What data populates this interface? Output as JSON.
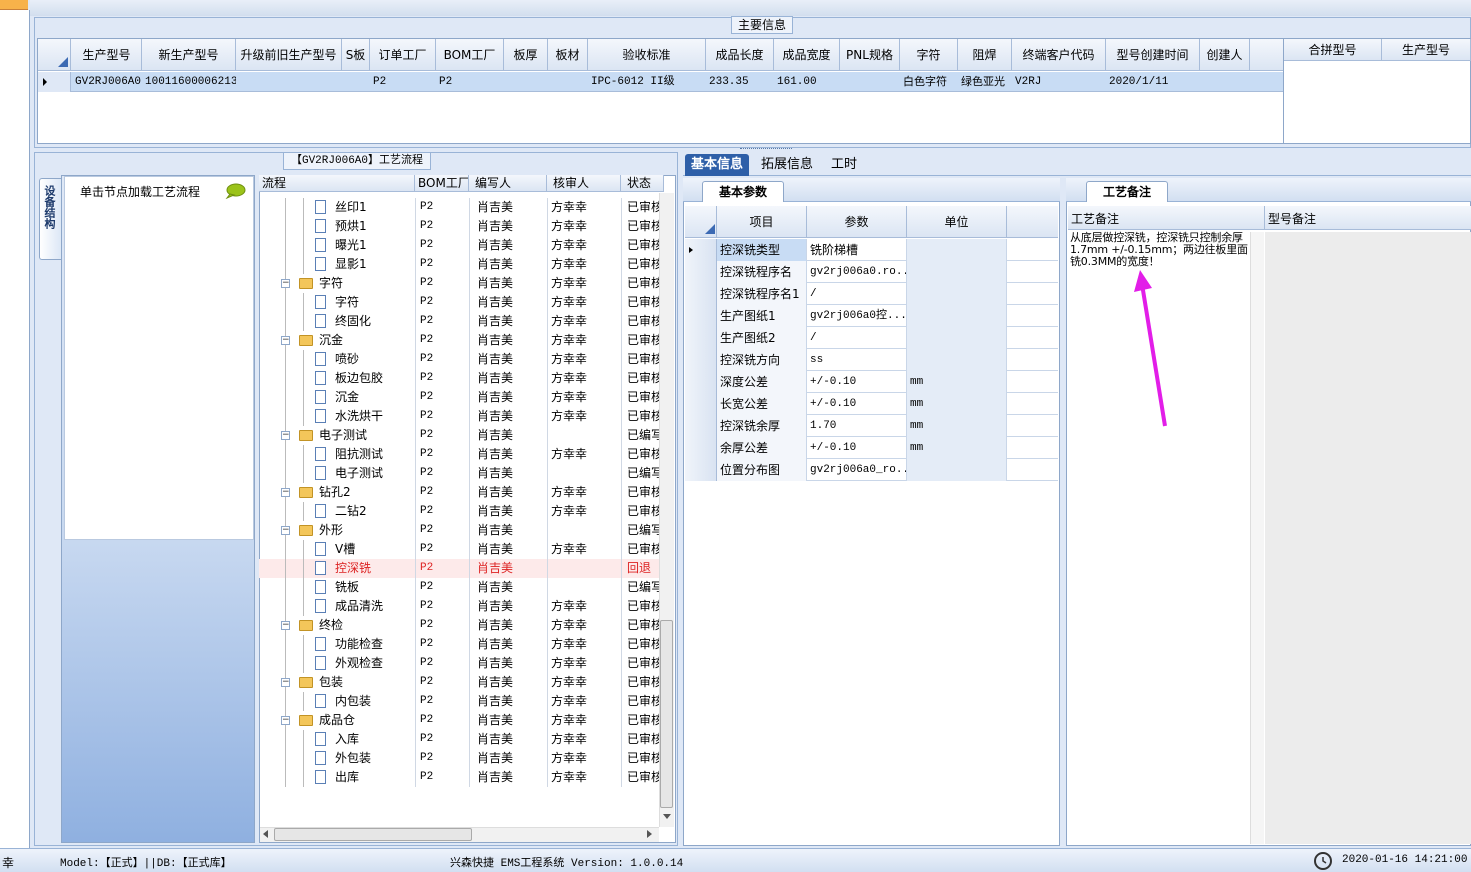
{
  "main": {
    "group_title": "主要信息",
    "columns": [
      "生产型号",
      "新生产型号",
      "升级前旧生产型号",
      "S板",
      "订单工厂",
      "BOM工厂",
      "板厚",
      "板材",
      "验收标准",
      "成品长度",
      "成品宽度",
      "PNL规格",
      "字符",
      "阻焊",
      "终端客户代码",
      "型号创建时间",
      "创建人"
    ],
    "row": [
      "GV2RJ006A0",
      "10011600006213",
      "",
      "",
      "P2",
      "P2",
      "",
      "",
      "IPC-6012 II级",
      "233.35",
      "161.00",
      "",
      "白色字符",
      "绿色亚光",
      "V2RJ",
      "2020/1/11",
      ""
    ],
    "side_columns": [
      "合拼型号",
      "生产型号"
    ]
  },
  "process": {
    "group_title": "【GV2RJ006A0】工艺流程",
    "vertical_tab": "设备结构",
    "nav_label": "单击节点加载工艺流程",
    "columns": [
      "流程",
      "BOM工厂",
      "编写人",
      "核审人",
      "状态"
    ],
    "rows": [
      {
        "name": "丝印1",
        "type": "doc",
        "level": 2,
        "bom": "P2",
        "writer": "肖吉美",
        "reviewer": "方幸幸",
        "status": "已审核"
      },
      {
        "name": "预烘1",
        "type": "doc",
        "level": 2,
        "bom": "P2",
        "writer": "肖吉美",
        "reviewer": "方幸幸",
        "status": "已审核"
      },
      {
        "name": "曝光1",
        "type": "doc",
        "level": 2,
        "bom": "P2",
        "writer": "肖吉美",
        "reviewer": "方幸幸",
        "status": "已审核"
      },
      {
        "name": "显影1",
        "type": "doc",
        "level": 2,
        "bom": "P2",
        "writer": "肖吉美",
        "reviewer": "方幸幸",
        "status": "已审核"
      },
      {
        "name": "字符",
        "type": "folder",
        "level": 1,
        "bom": "P2",
        "writer": "肖吉美",
        "reviewer": "方幸幸",
        "status": "已审核"
      },
      {
        "name": "字符",
        "type": "doc",
        "level": 2,
        "bom": "P2",
        "writer": "肖吉美",
        "reviewer": "方幸幸",
        "status": "已审核"
      },
      {
        "name": "终固化",
        "type": "doc",
        "level": 2,
        "bom": "P2",
        "writer": "肖吉美",
        "reviewer": "方幸幸",
        "status": "已审核"
      },
      {
        "name": "沉金",
        "type": "folder",
        "level": 1,
        "bom": "P2",
        "writer": "肖吉美",
        "reviewer": "方幸幸",
        "status": "已审核"
      },
      {
        "name": "喷砂",
        "type": "doc",
        "level": 2,
        "bom": "P2",
        "writer": "肖吉美",
        "reviewer": "方幸幸",
        "status": "已审核"
      },
      {
        "name": "板边包胶",
        "type": "doc",
        "level": 2,
        "bom": "P2",
        "writer": "肖吉美",
        "reviewer": "方幸幸",
        "status": "已审核"
      },
      {
        "name": "沉金",
        "type": "doc",
        "level": 2,
        "bom": "P2",
        "writer": "肖吉美",
        "reviewer": "方幸幸",
        "status": "已审核"
      },
      {
        "name": "水洗烘干",
        "type": "doc",
        "level": 2,
        "bom": "P2",
        "writer": "肖吉美",
        "reviewer": "方幸幸",
        "status": "已审核"
      },
      {
        "name": "电子测试",
        "type": "folder",
        "level": 1,
        "bom": "P2",
        "writer": "肖吉美",
        "reviewer": "",
        "status": "已编写"
      },
      {
        "name": "阻抗测试",
        "type": "doc",
        "level": 2,
        "bom": "P2",
        "writer": "肖吉美",
        "reviewer": "方幸幸",
        "status": "已审核"
      },
      {
        "name": "电子测试",
        "type": "doc",
        "level": 2,
        "bom": "P2",
        "writer": "肖吉美",
        "reviewer": "",
        "status": "已编写"
      },
      {
        "name": "钻孔2",
        "type": "folder",
        "level": 1,
        "bom": "P2",
        "writer": "肖吉美",
        "reviewer": "方幸幸",
        "status": "已审核"
      },
      {
        "name": "二钻2",
        "type": "doc",
        "level": 2,
        "bom": "P2",
        "writer": "肖吉美",
        "reviewer": "方幸幸",
        "status": "已审核"
      },
      {
        "name": "外形",
        "type": "folder",
        "level": 1,
        "bom": "P2",
        "writer": "肖吉美",
        "reviewer": "",
        "status": "已编写"
      },
      {
        "name": "V槽",
        "type": "doc",
        "level": 2,
        "bom": "P2",
        "writer": "肖吉美",
        "reviewer": "方幸幸",
        "status": "已审核"
      },
      {
        "name": "控深铣",
        "type": "doc",
        "level": 2,
        "bom": "P2",
        "writer": "肖吉美",
        "reviewer": "",
        "status": "回退",
        "selected": true
      },
      {
        "name": "铣板",
        "type": "doc",
        "level": 2,
        "bom": "P2",
        "writer": "肖吉美",
        "reviewer": "",
        "status": "已编写"
      },
      {
        "name": "成品清洗",
        "type": "doc",
        "level": 2,
        "bom": "P2",
        "writer": "肖吉美",
        "reviewer": "方幸幸",
        "status": "已审核"
      },
      {
        "name": "终检",
        "type": "folder",
        "level": 1,
        "bom": "P2",
        "writer": "肖吉美",
        "reviewer": "方幸幸",
        "status": "已审核"
      },
      {
        "name": "功能检查",
        "type": "doc",
        "level": 2,
        "bom": "P2",
        "writer": "肖吉美",
        "reviewer": "方幸幸",
        "status": "已审核"
      },
      {
        "name": "外观检查",
        "type": "doc",
        "level": 2,
        "bom": "P2",
        "writer": "肖吉美",
        "reviewer": "方幸幸",
        "status": "已审核"
      },
      {
        "name": "包装",
        "type": "folder",
        "level": 1,
        "bom": "P2",
        "writer": "肖吉美",
        "reviewer": "方幸幸",
        "status": "已审核"
      },
      {
        "name": "内包装",
        "type": "doc",
        "level": 2,
        "bom": "P2",
        "writer": "肖吉美",
        "reviewer": "方幸幸",
        "status": "已审核"
      },
      {
        "name": "成品仓",
        "type": "folder",
        "level": 1,
        "bom": "P2",
        "writer": "肖吉美",
        "reviewer": "方幸幸",
        "status": "已审核"
      },
      {
        "name": "入库",
        "type": "doc",
        "level": 2,
        "bom": "P2",
        "writer": "肖吉美",
        "reviewer": "方幸幸",
        "status": "已审核"
      },
      {
        "name": "外包装",
        "type": "doc",
        "level": 2,
        "bom": "P2",
        "writer": "肖吉美",
        "reviewer": "方幸幸",
        "status": "已审核"
      },
      {
        "name": "出库",
        "type": "doc",
        "level": 2,
        "bom": "P2",
        "writer": "肖吉美",
        "reviewer": "方幸幸",
        "status": "已审核"
      }
    ]
  },
  "tabs": [
    "基本信息",
    "拓展信息",
    "工时"
  ],
  "basic": {
    "tab": "基本参数",
    "columns": [
      "项目",
      "参数",
      "单位"
    ],
    "rows": [
      {
        "item": "控深铣类型",
        "param": "铣阶梯槽",
        "unit": ""
      },
      {
        "item": "控深铣程序名",
        "param": "gv2rj006a0.ro...",
        "unit": ""
      },
      {
        "item": "控深铣程序名1",
        "param": "/",
        "unit": ""
      },
      {
        "item": "生产图纸1",
        "param": "gv2rj006a0控...",
        "unit": ""
      },
      {
        "item": "生产图纸2",
        "param": "/",
        "unit": ""
      },
      {
        "item": "控深铣方向",
        "param": "ss",
        "unit": ""
      },
      {
        "item": "深度公差",
        "param": "+/-0.10",
        "unit": "mm"
      },
      {
        "item": "长宽公差",
        "param": "+/-0.10",
        "unit": "mm"
      },
      {
        "item": "控深铣余厚",
        "param": "1.70",
        "unit": "mm"
      },
      {
        "item": "余厚公差",
        "param": "+/-0.10",
        "unit": "mm"
      },
      {
        "item": "位置分布图",
        "param": "gv2rj006a0_ro...",
        "unit": ""
      }
    ]
  },
  "remark": {
    "tab": "工艺备注",
    "col_process": "工艺备注",
    "col_type": "型号备注",
    "text": "从底层做控深铣，控深铣只控制余厚 1.7mm +/-0.15mm；两边往板里面铣0.3MM的宽度！",
    "annotation_color": "#e21ee8"
  },
  "status": {
    "left_char": "幸",
    "model": "Model:【正式】||DB:【正式库】",
    "system": "兴森快捷 EMS工程系统 Version: 1.0.0.14",
    "datetime": "2020-01-16 14:21:00"
  }
}
